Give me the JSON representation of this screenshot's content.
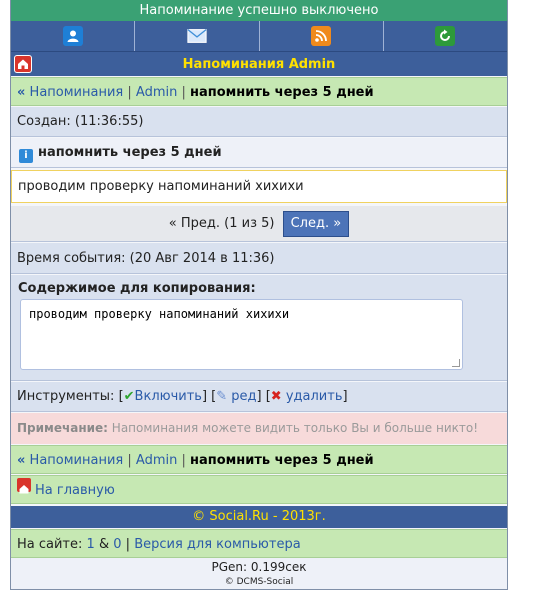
{
  "notice": "Напоминание успешно выключено",
  "iconbar": [
    {
      "icon": "user-icon",
      "color": "#1e7fd6"
    },
    {
      "icon": "mail-icon",
      "color": "#3f8fd8"
    },
    {
      "icon": "rss-icon",
      "color": "#f08a1c"
    },
    {
      "icon": "refresh-icon",
      "color": "#2d9a3a"
    }
  ],
  "title": "Напоминания Admin",
  "breadcrumb": {
    "raquo": "«",
    "link1": "Напоминания",
    "sep1": "|",
    "link2": "Admin",
    "sep2": "|",
    "current": "напомнить через 5 дней"
  },
  "created": "Создан: (11:36:55)",
  "subject": "напомнить через 5 дней",
  "message": "проводим проверку напоминаний хихихи",
  "pager": {
    "prev": "« Пред.",
    "pos": "(1 из 5)",
    "next": "След. »"
  },
  "event": "Время события: (20 Авг 2014 в 11:36)",
  "copy": {
    "title": "Содержимое для копирования:",
    "text": "проводим проверку напоминаний хихихи"
  },
  "tools": {
    "label": "Инструменты:",
    "enable": "Включить",
    "edit": "ред",
    "delete": "удалить"
  },
  "note": {
    "label": "Примечание:",
    "text": "Напоминания можете видить только Вы и больше никто!"
  },
  "home_link": "На главную",
  "copyright": "© Social.Ru - 2013г.",
  "online": {
    "label": "На сайте:",
    "n1": "1",
    "amp": "&",
    "n2": "0",
    "sep": "|",
    "desktop": "Версия для компьютера"
  },
  "pgen": "PGen: 0.199сек",
  "engine": "© DCMS-Social",
  "colors": {
    "header_blue": "#3d5f9b",
    "notice_green": "#3aa174",
    "title_yellow": "#ffe100",
    "crumb_green": "#c6e8b3",
    "light_blue": "#d9e1ef"
  }
}
